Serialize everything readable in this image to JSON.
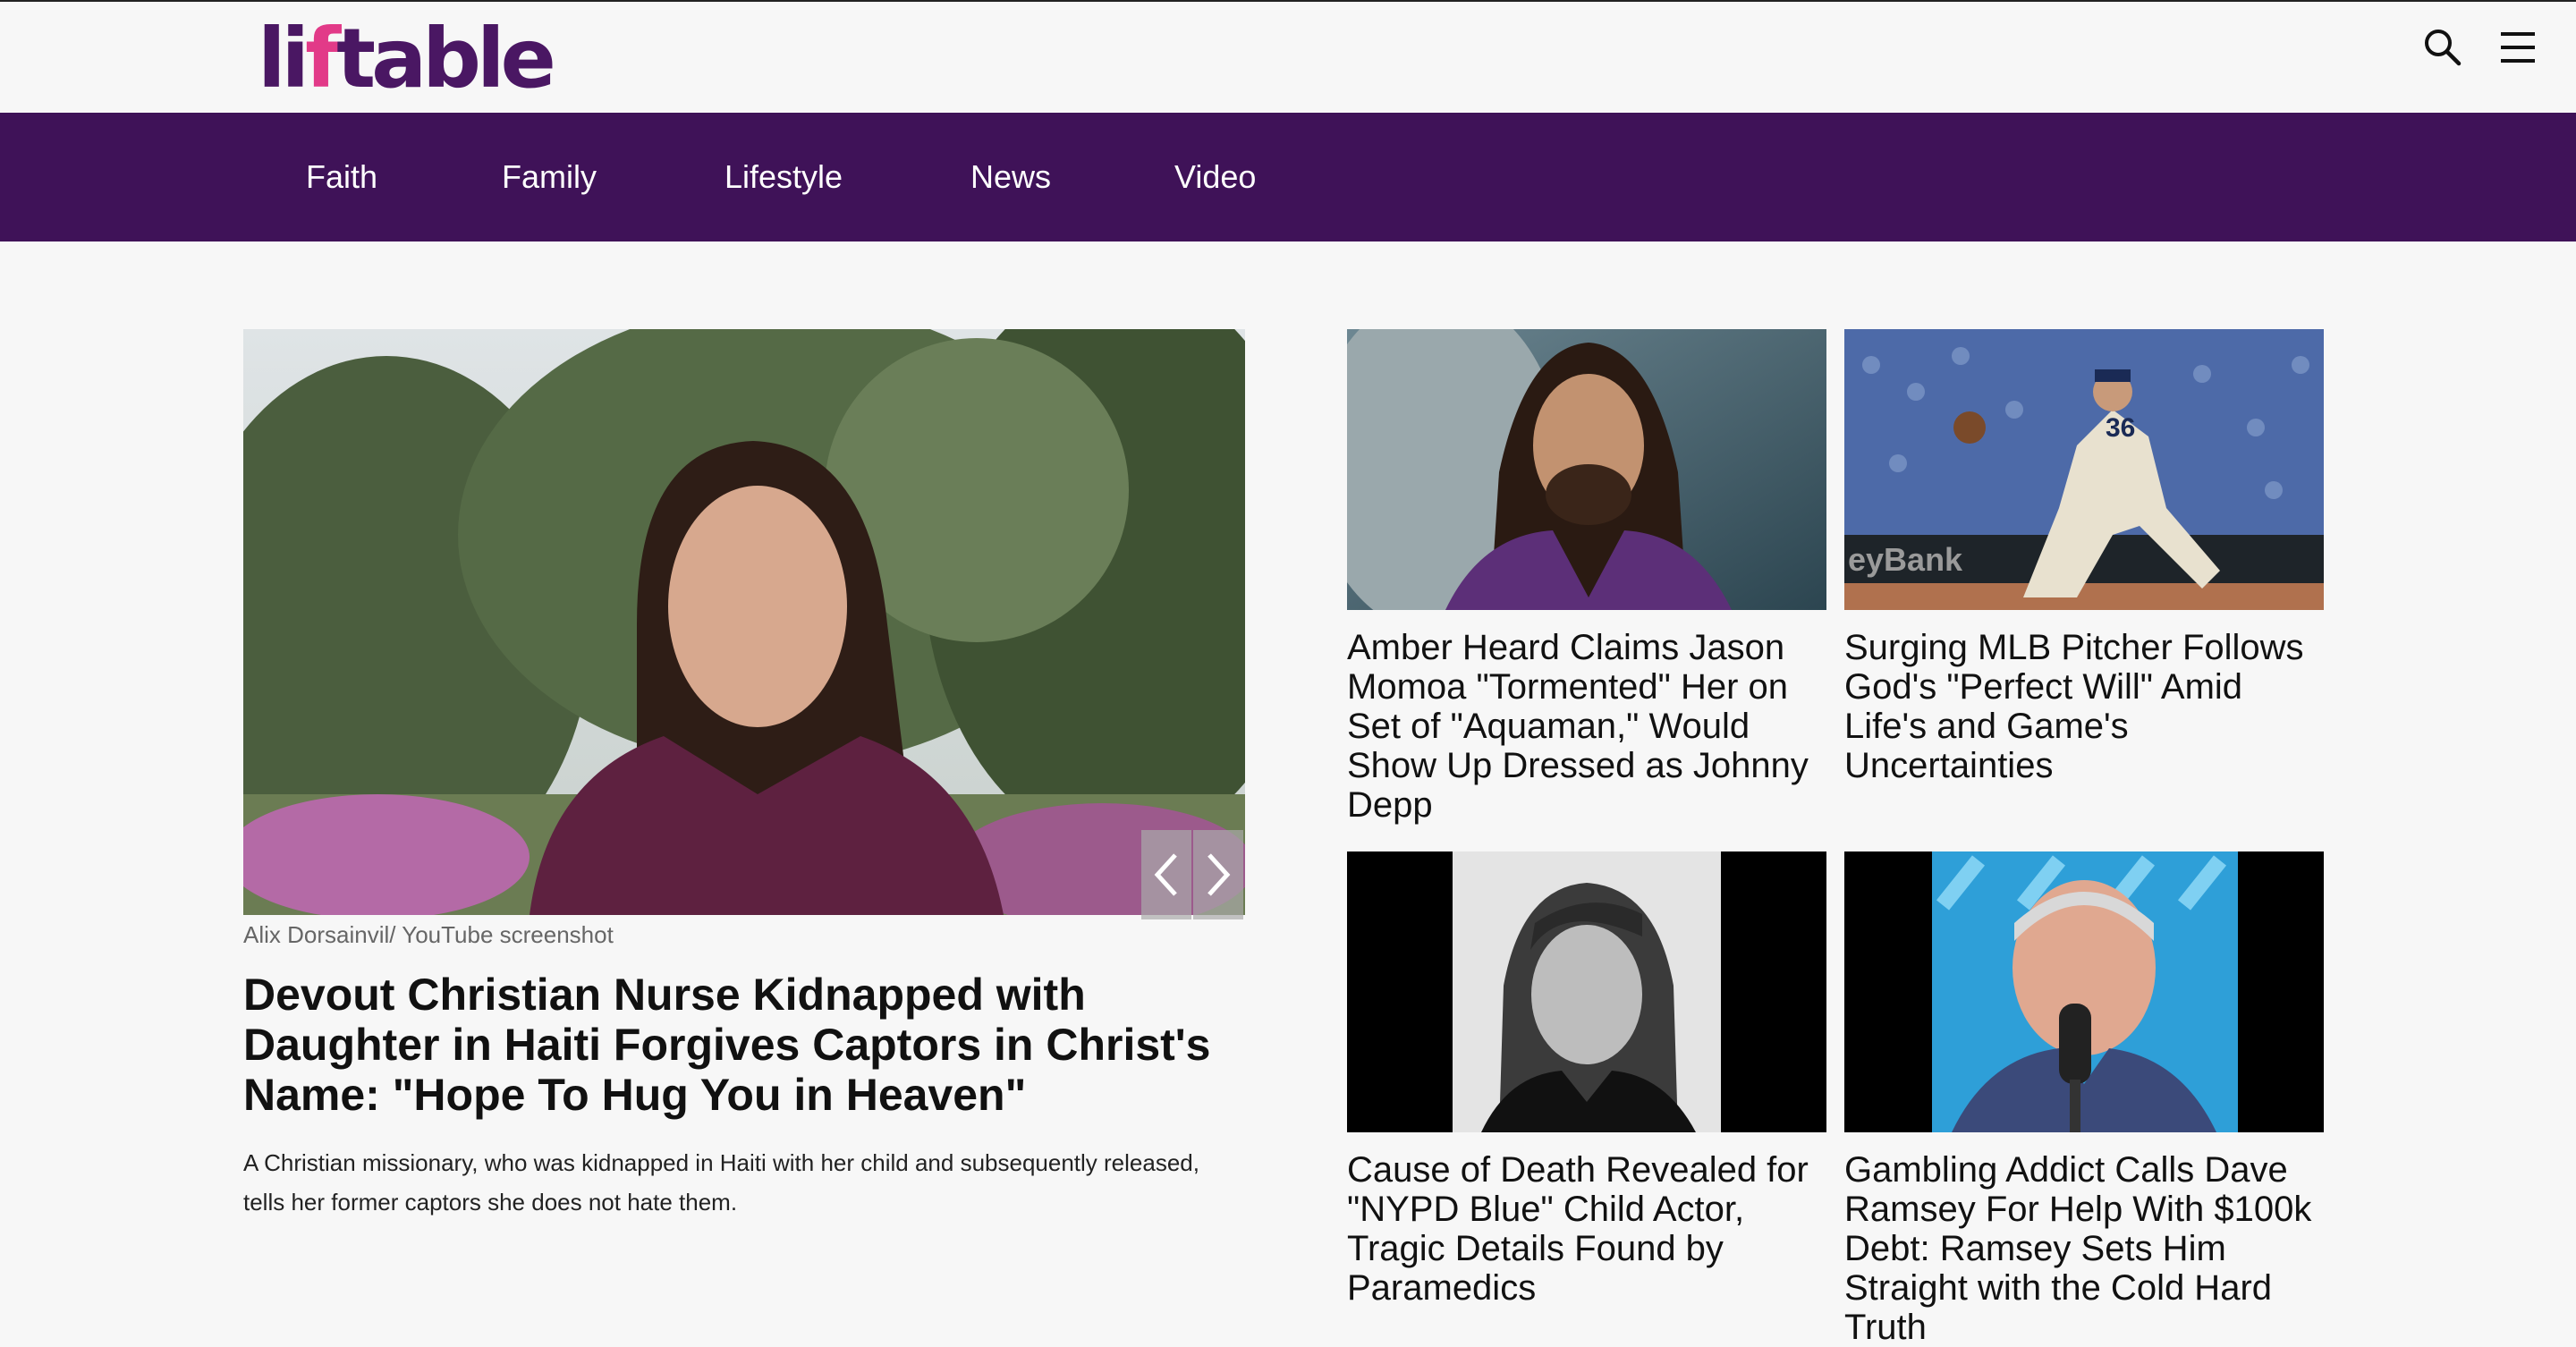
{
  "header": {
    "logo_text": "liftable",
    "logo_text_start": "li",
    "logo_text_arrow": "f",
    "logo_text_end": "table",
    "search_icon": "search-icon",
    "menu_icon": "hamburger-menu-icon"
  },
  "nav": {
    "items": [
      {
        "label": "Faith"
      },
      {
        "label": "Family"
      },
      {
        "label": "Lifestyle"
      },
      {
        "label": "News"
      },
      {
        "label": "Video"
      }
    ]
  },
  "hero": {
    "credit": "Alix Dorsainvil/ YouTube screenshot",
    "title": "Devout Christian Nurse Kidnapped with Daughter in Haiti Forgives Captors in Christ's Name: \"Hope To Hug You in Heaven\"",
    "description": "A Christian missionary, who was kidnapped in Haiti with her child and subsequently released, tells her former captors she does not hate them.",
    "prev_icon": "chevron-left-icon",
    "next_icon": "chevron-right-icon"
  },
  "cards": [
    {
      "title": "Amber Heard Claims Jason Momoa \"Tormented\" Her on Set of \"Aquaman,\" Would Show Up Dressed as Johnny Depp"
    },
    {
      "title": "Surging MLB Pitcher Follows God's \"Perfect Will\" Amid Life's and Game's Uncertainties",
      "image_text": "eyBank",
      "jersey_number": "36"
    },
    {
      "title": "Cause of Death Revealed for \"NYPD Blue\" Child Actor, Tragic Details Found by Paramedics"
    },
    {
      "title": "Gambling Addict Calls Dave Ramsey For Help With $100k Debt: Ramsey Sets Him Straight with the Cold Hard Truth"
    }
  ],
  "colors": {
    "nav_bg": "#3f1258",
    "logo_purple": "#4a1763",
    "logo_accent": "#e23a88",
    "page_bg": "#f7f7f7"
  }
}
